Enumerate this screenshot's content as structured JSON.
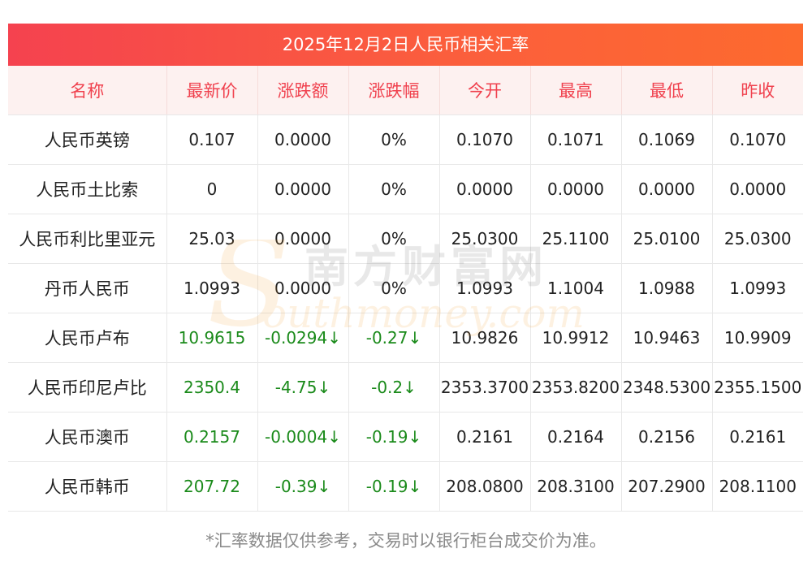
{
  "title": "2025年12月2日人民币相关汇率",
  "headers": [
    "名称",
    "最新价",
    "涨跌额",
    "涨跌幅",
    "今开",
    "最高",
    "最低",
    "昨收"
  ],
  "rows": [
    {
      "name": "人民币英镑",
      "latest": "0.107",
      "change": "0.0000",
      "pct": "0%",
      "open": "0.1070",
      "high": "0.1071",
      "low": "0.1069",
      "prev": "0.1070",
      "down": false
    },
    {
      "name": "人民币土比索",
      "latest": "0",
      "change": "0.0000",
      "pct": "0%",
      "open": "0.0000",
      "high": "0.0000",
      "low": "0.0000",
      "prev": "0.0000",
      "down": false
    },
    {
      "name": "人民币利比里亚元",
      "latest": "25.03",
      "change": "0.0000",
      "pct": "0%",
      "open": "25.0300",
      "high": "25.1100",
      "low": "25.0100",
      "prev": "25.0300",
      "down": false
    },
    {
      "name": "丹币人民币",
      "latest": "1.0993",
      "change": "0.0000",
      "pct": "0%",
      "open": "1.0993",
      "high": "1.1004",
      "low": "1.0988",
      "prev": "1.0993",
      "down": false
    },
    {
      "name": "人民币卢布",
      "latest": "10.9615",
      "change": "-0.0294↓",
      "pct": "-0.27↓",
      "open": "10.9826",
      "high": "10.9912",
      "low": "10.9463",
      "prev": "10.9909",
      "down": true
    },
    {
      "name": "人民币印尼卢比",
      "latest": "2350.4",
      "change": "-4.75↓",
      "pct": "-0.2↓",
      "open": "2353.3700",
      "high": "2353.8200",
      "low": "2348.5300",
      "prev": "2355.1500",
      "down": true
    },
    {
      "name": "人民币澳币",
      "latest": "0.2157",
      "change": "-0.0004↓",
      "pct": "-0.19↓",
      "open": "0.2161",
      "high": "0.2164",
      "low": "0.2156",
      "prev": "0.2161",
      "down": true
    },
    {
      "name": "人民币韩币",
      "latest": "207.72",
      "change": "-0.39↓",
      "pct": "-0.19↓",
      "open": "208.0800",
      "high": "208.3100",
      "low": "207.2900",
      "prev": "208.1100",
      "down": true
    }
  ],
  "watermark": {
    "cn": "南方财富网",
    "en": "outhmoney.com"
  },
  "footnote": "*汇率数据仅供参考，交易时以银行柜台成交价为准。",
  "colors": {
    "title_bg": "#f5424f",
    "header_text": "#f0414e",
    "header_bg": "#fdf1f0",
    "down": "#1a8a1a"
  }
}
